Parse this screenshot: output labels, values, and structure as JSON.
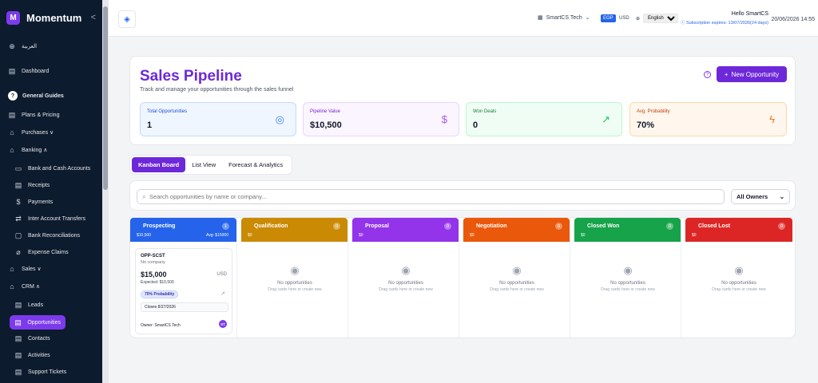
{
  "sidebar": {
    "brand_letter": "M",
    "brand": "Momentum",
    "collapse": "<",
    "lang_switch": "العربية",
    "items": [
      {
        "label": "Dashboard"
      },
      {
        "label": "General Guides",
        "num": "?"
      },
      {
        "label": "Plans & Pricing"
      },
      {
        "label": "Purchases ∨"
      },
      {
        "label": "Banking ∧"
      },
      {
        "label": "Bank and Cash Accounts"
      },
      {
        "label": "Receipts"
      },
      {
        "label": "Payments"
      },
      {
        "label": "Inter Account Transfers"
      },
      {
        "label": "Bank Reconciliations"
      },
      {
        "label": "Expense Claims"
      },
      {
        "label": "Sales ∨"
      },
      {
        "label": "CRM ∧"
      },
      {
        "label": "Leads"
      },
      {
        "label": "Opportunities"
      },
      {
        "label": "Contacts"
      },
      {
        "label": "Activities"
      },
      {
        "label": "Support Tickets"
      }
    ]
  },
  "topbar": {
    "company": "SmartCS Tech",
    "currency_active": "EGP",
    "currency_other": "USD",
    "language": "English",
    "hello": "Hello SmartCS",
    "subscription": "Subscription expires: 13/07/2026(24 days)",
    "datetime": "20/06/2026 14:55"
  },
  "header": {
    "title": "Sales Pipeline",
    "subtitle": "Track and manage your opportunities through the sales funnel",
    "help": "?",
    "new_button": "New Opportunity"
  },
  "stats": [
    {
      "label": "Total Opportunities",
      "value": "1",
      "color": "#3b82f6"
    },
    {
      "label": "Pipeline Value",
      "value": "$10,500",
      "color": "#a855f7"
    },
    {
      "label": "Won Deals",
      "value": "0",
      "color": "#22c55e"
    },
    {
      "label": "Avg. Probability",
      "value": "70%",
      "color": "#f97316"
    }
  ],
  "tabs": [
    "Kanban Board",
    "List View",
    "Forecast & Analytics"
  ],
  "search": {
    "placeholder": "Search opportunities by name or company..."
  },
  "owner_filter": "All Owners",
  "columns": [
    {
      "name": "Prospecting",
      "value": "$10,500",
      "avg": "Avg: $15000",
      "count": "1",
      "color": "#2563eb"
    },
    {
      "name": "Qualification",
      "value": "$0",
      "count": "0",
      "color": "#ca8a04"
    },
    {
      "name": "Proposal",
      "value": "$0",
      "count": "0",
      "color": "#9333ea"
    },
    {
      "name": "Negotiation",
      "value": "$0",
      "count": "0",
      "color": "#ea580c"
    },
    {
      "name": "Closed Won",
      "value": "$0",
      "count": "0",
      "color": "#16a34a"
    },
    {
      "name": "Closed Lost",
      "value": "$0",
      "count": "0",
      "color": "#dc2626"
    }
  ],
  "empty": {
    "title": "No opportunities",
    "hint": "Drag cards here or create new"
  },
  "opportunity": {
    "code": "OPP-SCST",
    "company": "No company",
    "amount": "$15,000",
    "currency": "USD",
    "expected": "Expected: $10,500",
    "probability": "70% Probability",
    "closes": "Closes 8/27/2026",
    "owner": "Owner: SmartCS Tech",
    "avatar": "ST"
  }
}
